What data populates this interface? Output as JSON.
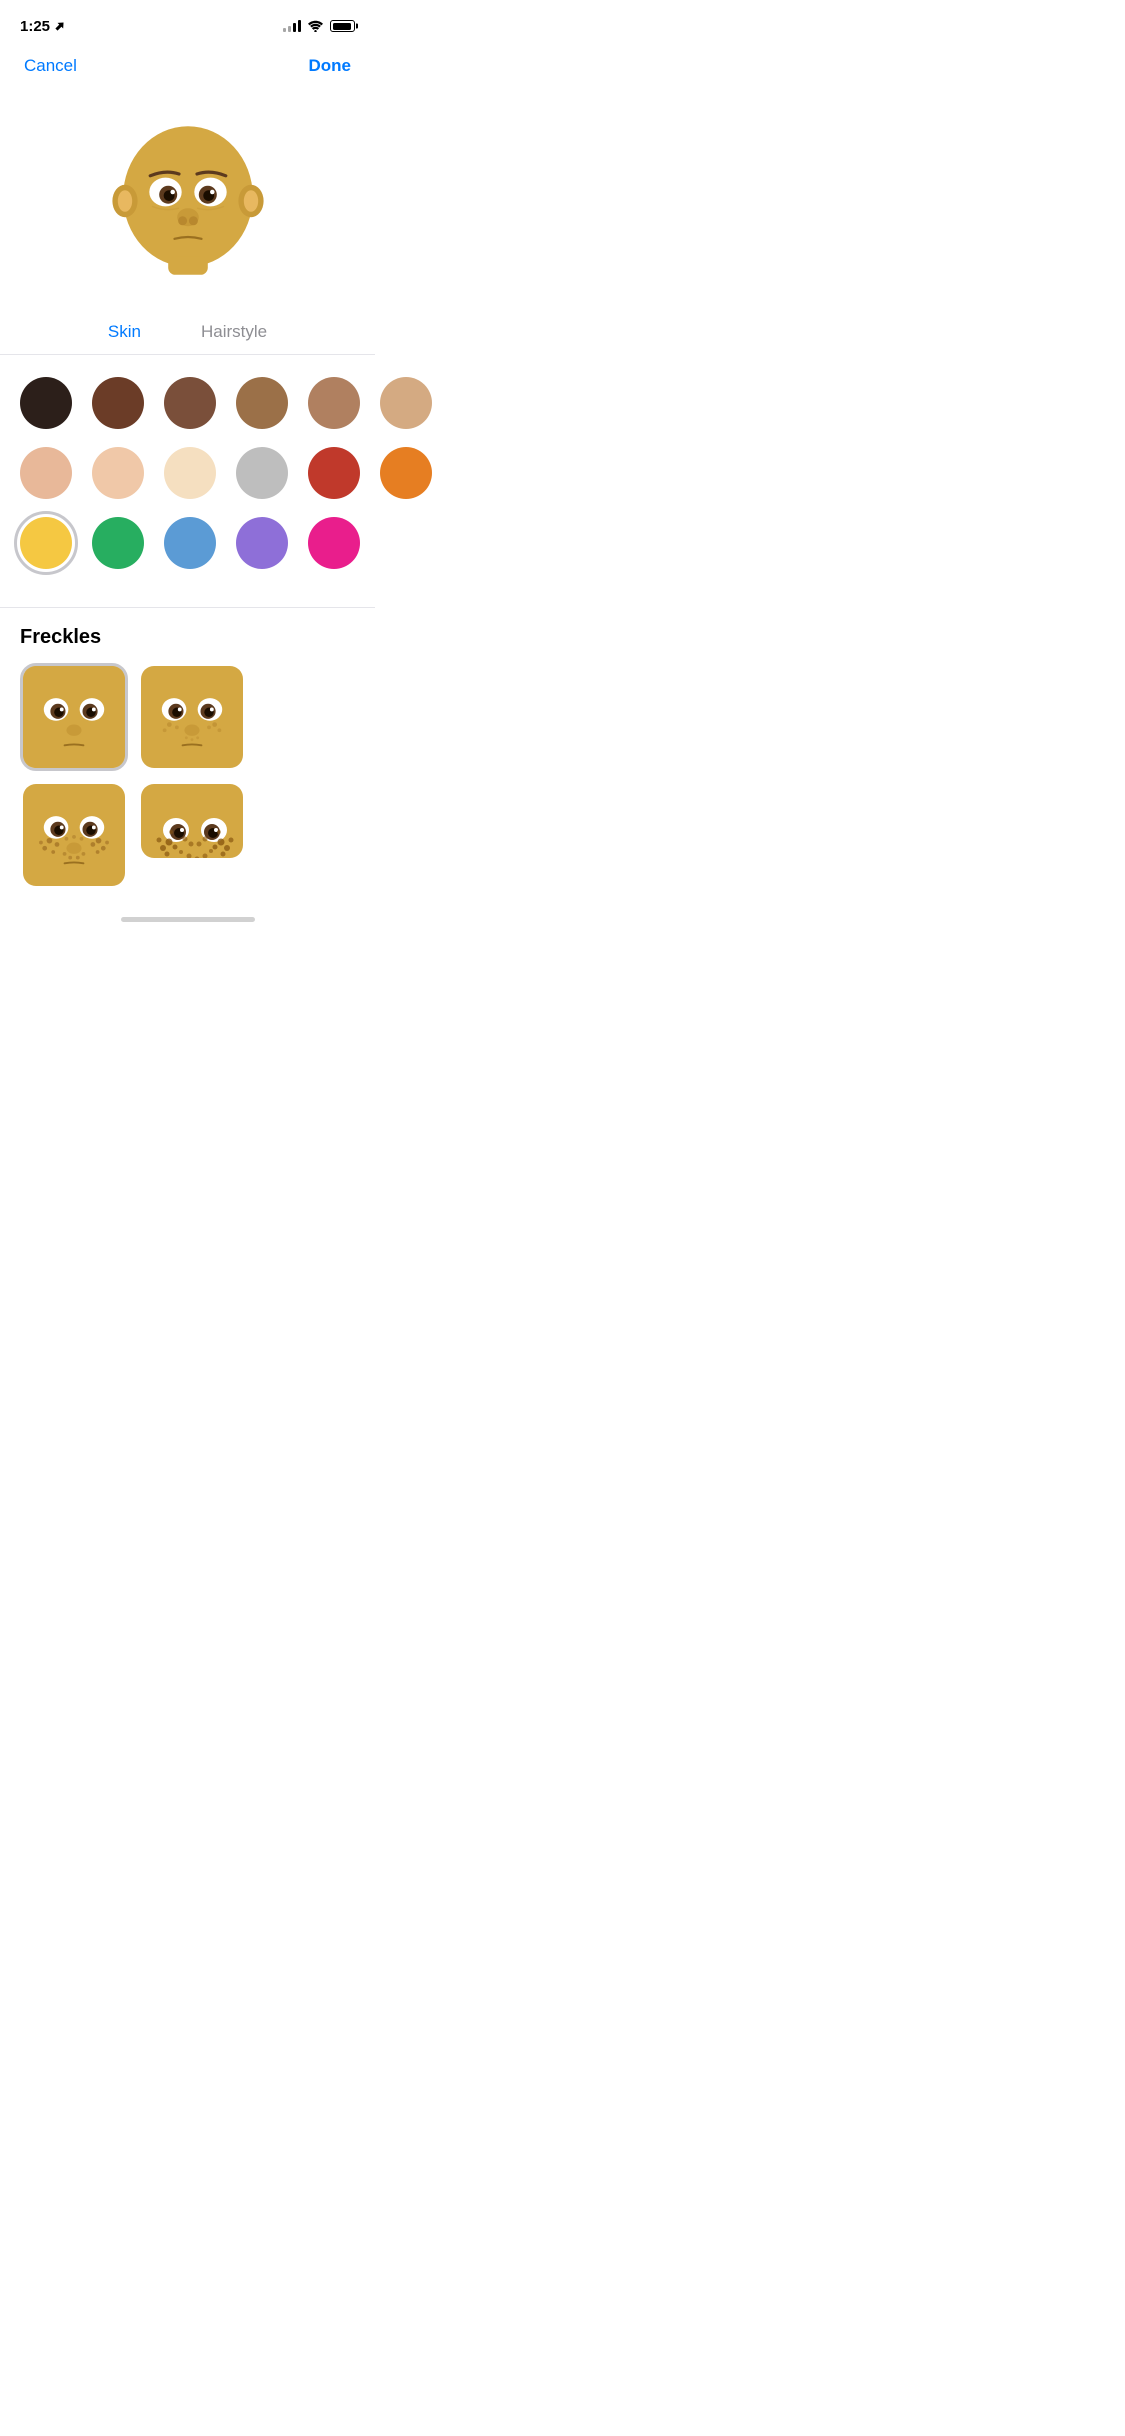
{
  "statusBar": {
    "time": "1:25",
    "locationIcon": "◁",
    "signalBars": 2,
    "battery": 90
  },
  "nav": {
    "cancelLabel": "Cancel",
    "doneLabel": "Done"
  },
  "tabs": [
    {
      "id": "skin",
      "label": "Skin",
      "active": true
    },
    {
      "id": "hairstyle",
      "label": "Hairstyle",
      "active": false
    }
  ],
  "colorSwatches": [
    [
      {
        "color": "#2C1F1A",
        "selected": false
      },
      {
        "color": "#6B3C27",
        "selected": false
      },
      {
        "color": "#7A4F3A",
        "selected": false
      },
      {
        "color": "#9B7048",
        "selected": false
      },
      {
        "color": "#B08060",
        "selected": false
      },
      {
        "color": "#D4AA82",
        "selected": false
      }
    ],
    [
      {
        "color": "#E8B899",
        "selected": false
      },
      {
        "color": "#F0C8A8",
        "selected": false
      },
      {
        "color": "#F5DFC0",
        "selected": false
      },
      {
        "color": "#BEBEBE",
        "selected": false
      },
      {
        "color": "#C0392B",
        "selected": false
      },
      {
        "color": "#E67E22",
        "selected": false
      }
    ],
    [
      {
        "color": "#F5C842",
        "selected": true
      },
      {
        "color": "#27AE60",
        "selected": false
      },
      {
        "color": "#5B9BD5",
        "selected": false
      },
      {
        "color": "#8E6FD8",
        "selected": false
      },
      {
        "color": "#E91E8C",
        "selected": false
      }
    ]
  ],
  "freckles": {
    "title": "Freckles",
    "items": [
      {
        "id": 0,
        "selected": true,
        "type": "none"
      },
      {
        "id": 1,
        "selected": false,
        "type": "light"
      },
      {
        "id": 2,
        "selected": false,
        "type": "heavy"
      },
      {
        "id": 3,
        "selected": false,
        "type": "full"
      }
    ]
  }
}
